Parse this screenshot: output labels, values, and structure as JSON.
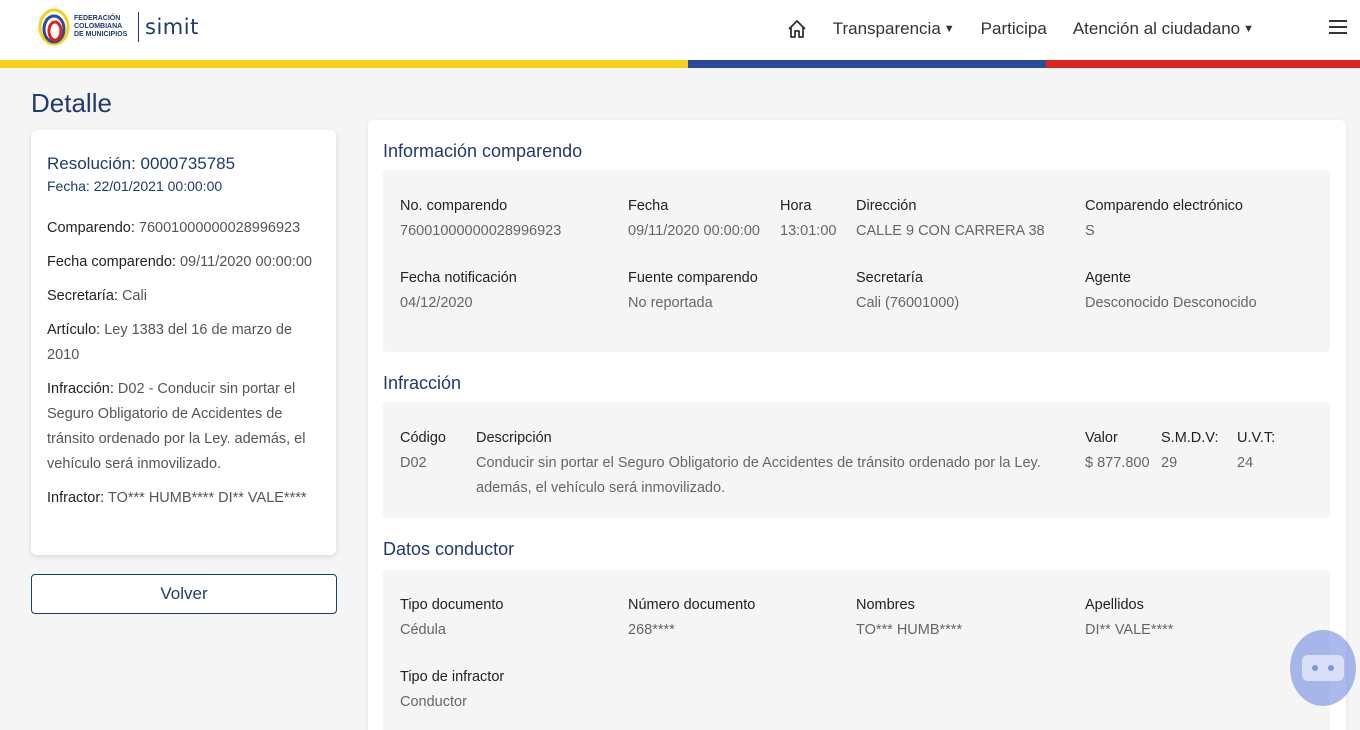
{
  "header": {
    "logo_text": "FEDERACIÓN COLOMBIANA DE MUNICIPIOS",
    "brand": "simit",
    "nav": [
      {
        "label": "Transparencia",
        "has_dropdown": true
      },
      {
        "label": "Participa",
        "has_dropdown": false
      },
      {
        "label": "Atención al ciudadano",
        "has_dropdown": true
      }
    ],
    "icons": {
      "home": "home-icon",
      "menu": "hamburger-menu-icon"
    }
  },
  "colors": {
    "primary": "#1f3a6e",
    "yellow": "#f7d117",
    "blue": "#2c4a9a",
    "red": "#d9261c"
  },
  "page_title": "Detalle",
  "summary": {
    "resolucion": "Resolución: 0000735785",
    "fecha": "Fecha: 22/01/2021 00:00:00",
    "items": [
      {
        "label": "Comparendo:",
        "value": " 76001000000028996923"
      },
      {
        "label": "Fecha comparendo:",
        "value": " 09/11/2020 00:00:00"
      },
      {
        "label": "Secretaría:",
        "value": " Cali"
      },
      {
        "label": "Artículo:",
        "value": " Ley 1383 del 16 de marzo de 2010"
      },
      {
        "label": "Infracción:",
        "value": " D02 - Conducir sin portar el Seguro Obligatorio de Accidentes de tránsito ordenado por la Ley. además, el vehículo será inmovilizado."
      },
      {
        "label": "Infractor:",
        "value": " TO*** HUMB**** DI** VALE****"
      }
    ]
  },
  "back_button": "Volver",
  "info": {
    "title": "Información comparendo",
    "fields": [
      {
        "label": "No. comparendo",
        "value": "76001000000028996923"
      },
      {
        "label": "Fecha",
        "value": "09/11/2020 00:00:00"
      },
      {
        "label": "Hora",
        "value": "13:01:00"
      },
      {
        "label": "Dirección",
        "value": "CALLE 9 CON CARRERA 38"
      },
      {
        "label": "Comparendo electrónico",
        "value": "S"
      },
      {
        "label": "Fecha notificación",
        "value": "04/12/2020"
      },
      {
        "label": "Fuente comparendo",
        "value": "No reportada"
      },
      {
        "label": "Secretaría",
        "value": "Cali (76001000)"
      },
      {
        "label": "Agente",
        "value": "Desconocido Desconocido"
      }
    ]
  },
  "infraccion": {
    "title": "Infracción",
    "fields": [
      {
        "label": "Código",
        "value": "D02"
      },
      {
        "label": "Descripción",
        "value": "Conducir sin portar el Seguro Obligatorio de Accidentes de tránsito ordenado por la Ley. además, el vehículo será inmovilizado."
      },
      {
        "label": "Valor",
        "value": "$ 877.800"
      },
      {
        "label": "S.M.D.V:",
        "value": "29"
      },
      {
        "label": "U.V.T:",
        "value": "24"
      }
    ]
  },
  "conductor": {
    "title": "Datos conductor",
    "fields": [
      {
        "label": "Tipo documento",
        "value": "Cédula"
      },
      {
        "label": "Número documento",
        "value": "268****"
      },
      {
        "label": "Nombres",
        "value": "TO*** HUMB****"
      },
      {
        "label": "Apellidos",
        "value": "DI** VALE****"
      },
      {
        "label": "Tipo de infractor",
        "value": "Conductor"
      }
    ]
  }
}
